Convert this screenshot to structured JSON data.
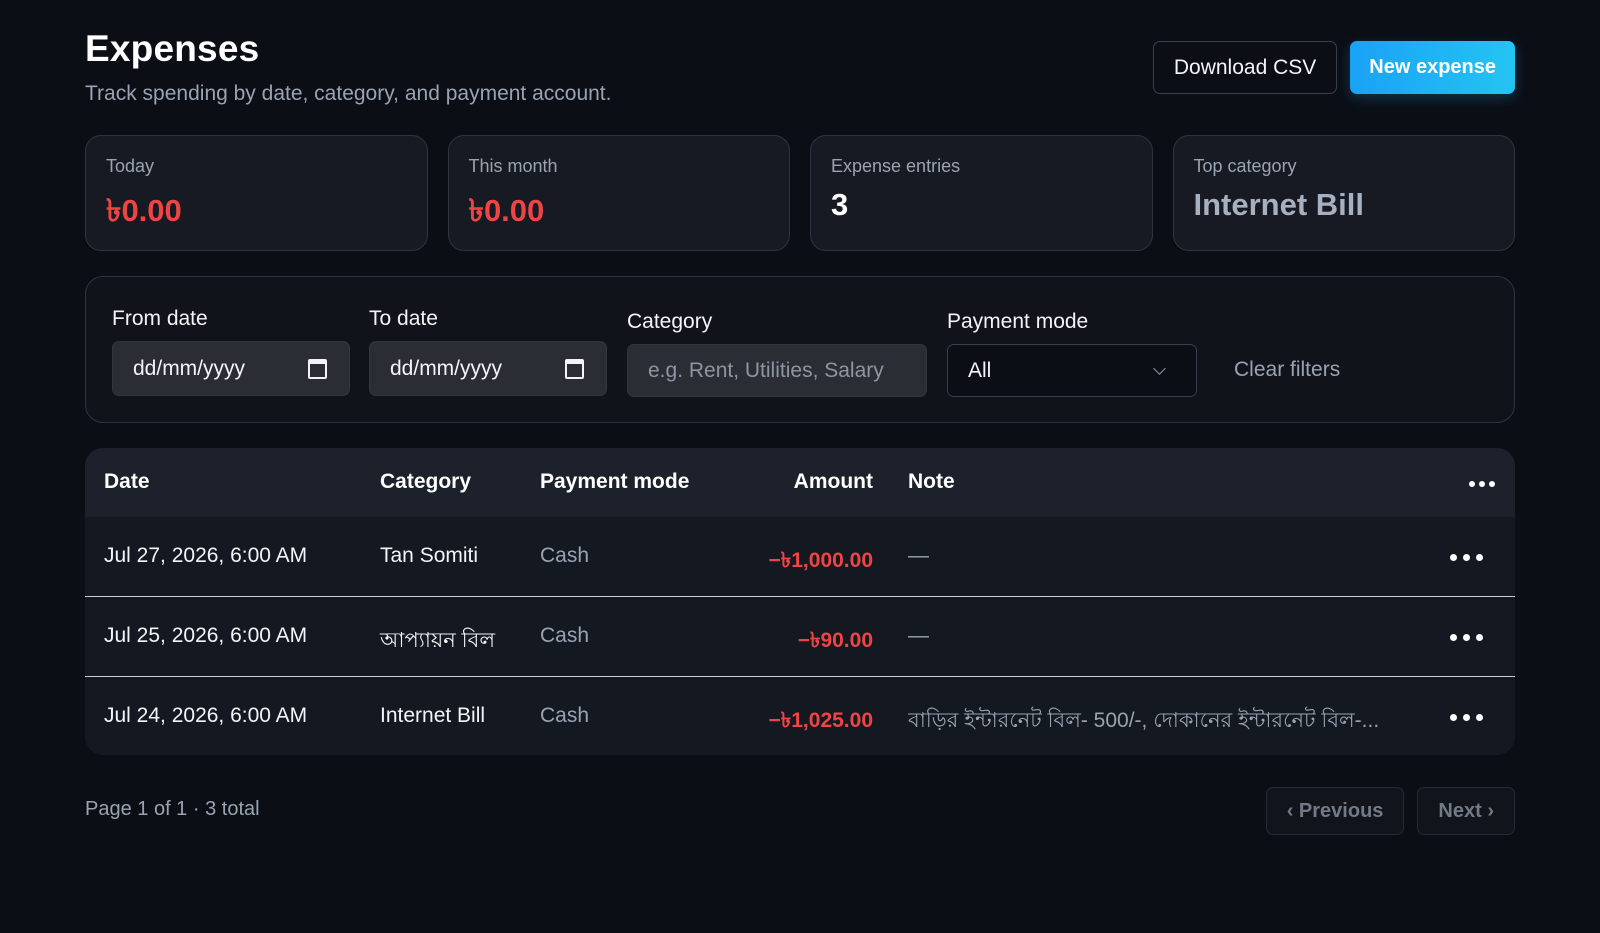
{
  "header": {
    "title": "Expenses",
    "subtitle": "Track spending by date, category, and payment account.",
    "download_label": "Download CSV",
    "new_label": "New expense"
  },
  "stats": [
    {
      "label": "Today",
      "value": "৳0.00"
    },
    {
      "label": "This month",
      "value": "৳0.00"
    },
    {
      "label": "Expense entries",
      "value": "3"
    },
    {
      "label": "Top category",
      "value": "Internet Bill"
    }
  ],
  "filters": {
    "from_label": "From date",
    "from_placeholder": "dd/mm/yyyy",
    "to_label": "To date",
    "to_placeholder": "dd/mm/yyyy",
    "category_label": "Category",
    "category_placeholder": "e.g. Rent, Utilities, Salary",
    "mode_label": "Payment mode",
    "mode_value": "All",
    "clear_label": "Clear filters"
  },
  "table": {
    "columns": {
      "date": "Date",
      "category": "Category",
      "mode": "Payment mode",
      "amount": "Amount",
      "note": "Note"
    },
    "rows": [
      {
        "date": "Jul 27, 2026, 6:00 AM",
        "category": "Tan Somiti",
        "mode": "Cash",
        "amount": "−৳1,000.00",
        "note": "—"
      },
      {
        "date": "Jul 25, 2026, 6:00 AM",
        "category": "আপ্যায়ন বিল",
        "mode": "Cash",
        "amount": "−৳90.00",
        "note": "—"
      },
      {
        "date": "Jul 24, 2026, 6:00 AM",
        "category": "Internet Bill",
        "mode": "Cash",
        "amount": "−৳1,025.00",
        "note": "বাড়ির ইন্টারনেট বিল- 500/-, দোকানের ইন্টারনেট বিল-..."
      }
    ]
  },
  "footer": {
    "page_info": "Page 1 of 1 · 3 total",
    "prev_label": "‹ Previous",
    "next_label": "Next ›"
  },
  "colors": {
    "accent": "#1aa2f5",
    "negative": "#ef4444",
    "background": "#0b0e15"
  }
}
